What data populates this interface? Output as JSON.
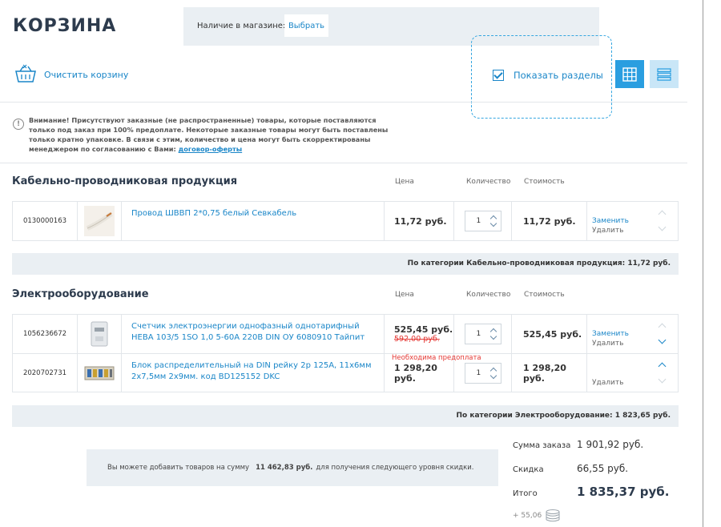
{
  "header": {
    "title": "КОРЗИНА",
    "store_label": "Наличие в магазине:",
    "store_button": "Выбрать",
    "clear_cart": "Очистить корзину",
    "show_sections": "Показать разделы"
  },
  "warning": {
    "text": "Внимание! Присутствуют заказные (не распространенные) товары, которые поставляются только под заказ при 100% предоплате. Некоторые заказные товары могут быть поставлены только кратно упаковке. В связи с этим, количество и цена могут быть скорректированы менеджером по согласованию с Вами:",
    "link": "договор-оферты"
  },
  "columns": {
    "price": "Цена",
    "qty": "Количество",
    "cost": "Стоимость"
  },
  "sections": [
    {
      "title": "Кабельно-проводниковая продукция",
      "subtotal": "По категории Кабельно-проводниковая продукция: 11,72 руб.",
      "items": [
        {
          "code": "0130000163",
          "name": "Провод ШВВП 2*0,75 белый Севкабель",
          "price": "11,72 руб.",
          "old_price": "",
          "qty": "1",
          "cost": "11,72 руб.",
          "replace": "Заменить",
          "delete": "Удалить"
        }
      ]
    },
    {
      "title": "Электрооборудование",
      "subtotal": "По категории Электрооборудование: 1 823,65 руб.",
      "items": [
        {
          "code": "1056236672",
          "name": "Счетчик электроэнергии однофазный однотарифный НЕВА 103/5 1SO 1,0 5-60А 220В DIN ОУ 6080910 Тайпит",
          "price": "525,45 руб.",
          "old_price": "592,00 руб.",
          "qty": "1",
          "cost": "525,45 руб.",
          "replace": "Заменить",
          "delete": "Удалить"
        },
        {
          "code": "2020702731",
          "name": "Блок распределительный на DIN рейку 2р 125А, 11х6мм 2х7,5мм 2х9мм. код BD125152 DKC",
          "price": "1 298,20 руб.",
          "old_price": "",
          "prepay": "Необходима предоплата",
          "qty": "1",
          "cost": "1 298,20 руб.",
          "replace": "",
          "delete": "Удалить"
        }
      ]
    }
  ],
  "discount": {
    "prefix": "Вы можете добавить товаров на сумму",
    "amount": "11 462,83 руб.",
    "suffix": "для получения следующего уровня скидки."
  },
  "totals": {
    "order_label": "Сумма заказа",
    "order_value": "1 901,92 руб.",
    "discount_label": "Скидка",
    "discount_value": "66,55 руб.",
    "total_label": "Итого",
    "total_value": "1 835,37 руб.",
    "bonus": "+ 55,06"
  },
  "colors": {
    "accent": "#1a86c8",
    "grid_active": "#2a9ee0",
    "panel": "#eaeff3",
    "alert": "#e53935"
  }
}
